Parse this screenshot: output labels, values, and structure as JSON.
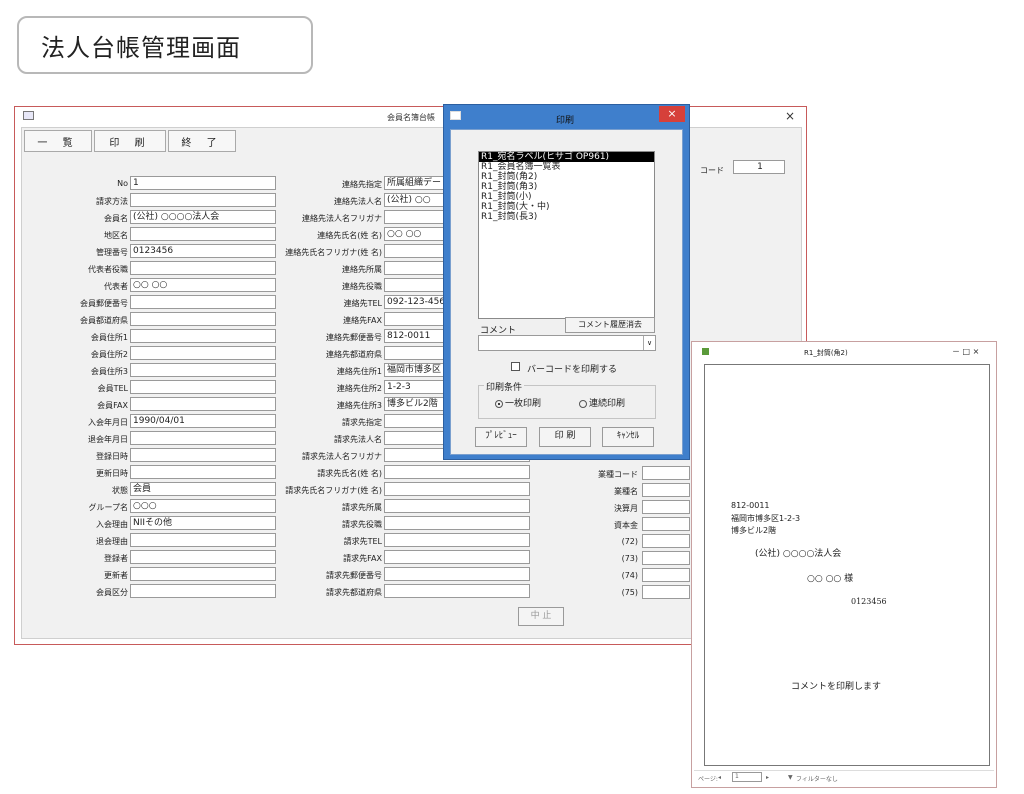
{
  "page_title": "法人台帳管理画面",
  "main": {
    "window_title": "会員名簿台帳",
    "close": "×",
    "toolbar": {
      "list": "一 覧",
      "print": "印 刷",
      "exit": "終 了"
    },
    "code_label": "コード",
    "code_value": "1",
    "left_labels": [
      "No",
      "請求方法",
      "会員名",
      "地区名",
      "管理番号",
      "代表者役職",
      "代表者",
      "会員郵便番号",
      "会員都道府県",
      "会員住所1",
      "会員住所2",
      "会員住所3",
      "会員TEL",
      "会員FAX",
      "入会年月日",
      "退会年月日",
      "登録日時",
      "更新日時",
      "状態",
      "グループ名",
      "入会理由",
      "退会理由",
      "登録者",
      "更新者",
      "会員区分"
    ],
    "left_values": [
      "1",
      "",
      "(公社) ○○○○法人会",
      "",
      "0123456",
      "",
      "○○ ○○",
      "",
      "",
      "",
      "",
      "",
      "",
      "",
      "1990/04/01",
      "",
      "",
      "",
      "会員",
      "○○○",
      "NIIその他",
      "",
      "",
      "",
      ""
    ],
    "mid_labels": [
      "連絡先指定",
      "連絡先法人名",
      "連絡先法人名フリガナ",
      "連絡先氏名(姓 名)",
      "連絡先氏名フリガナ(姓 名)",
      "連絡先所属",
      "連絡先役職",
      "連絡先TEL",
      "連絡先FAX",
      "連絡先郵便番号",
      "連絡先都道府県",
      "連絡先住所1",
      "連絡先住所2",
      "連絡先住所3",
      "請求先指定",
      "請求先法人名",
      "請求先法人名フリガナ",
      "請求先氏名(姓 名)",
      "請求先氏名フリガナ(姓 名)",
      "請求先所属",
      "請求先役職",
      "請求先TEL",
      "請求先FAX",
      "請求先郵便番号",
      "請求先都道府県"
    ],
    "mid_values": [
      "所属組織デー",
      "(公社) ○○",
      "",
      "○○ ○○",
      "",
      "",
      "",
      "092-123-456",
      "",
      "812-0011",
      "",
      "福岡市博多区",
      "1-2-3",
      "博多ビル2階",
      "",
      "",
      "",
      "",
      "",
      "",
      "",
      "",
      "",
      "",
      ""
    ],
    "right_labels": [
      "業種コード",
      "業種名",
      "決算月",
      "資本金",
      "(72)",
      "(73)",
      "(74)",
      "(75)"
    ],
    "stop_button": "中 止"
  },
  "dialog": {
    "title": "印刷",
    "close": "×",
    "reports": [
      "R1_宛名ラベル(ヒサゴ OP961)",
      "R1_会員名簿一覧表",
      "R1_封筒(角2)",
      "R1_封筒(角3)",
      "R1_封筒(小)",
      "R1_封筒(大・中)",
      "R1_封筒(長3)"
    ],
    "comment_label": "コメント",
    "comment_history_button": "コメント履歴消去",
    "barcode_label": "バーコードを印刷する",
    "print_condition_label": "印刷条件",
    "option_single": "一枚印刷",
    "option_continuous": "連続印刷",
    "preview_button": "ﾌﾟﾚﾋﾞｭｰ",
    "print_button": "印 刷",
    "cancel_button": "ｷｬﾝｾﾙ"
  },
  "preview": {
    "title": "R1_封筒(角2)",
    "controls": "－ □ ×",
    "zip": "812-0011",
    "addr1": "福岡市博多区1-2-3",
    "addr2": "博多ビル2階",
    "org": "(公社) ○○○○法人会",
    "person": "○○ ○○ 様",
    "code": "0123456",
    "comment": "コメントを印刷します",
    "page_label": "ページ:",
    "page_value": "1",
    "filter_label": "フィルターなし"
  }
}
